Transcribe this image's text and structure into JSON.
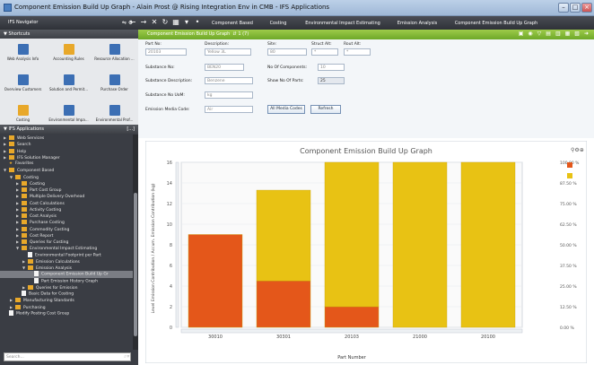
{
  "window": {
    "title": "Component Emission Build Up Graph - Alain Prost @ Rising Integration Env in CMB - IFS Applications"
  },
  "navbar": {
    "title": "IFS Navigator",
    "tabs": [
      "Component Based",
      "Costing",
      "Environmental Impact Estimating",
      "Emission Analysis",
      "Component Emission Build Up Graph"
    ]
  },
  "sidebar": {
    "shortcuts_header": "Shortcuts",
    "shortcuts": [
      "Web Analysis Info",
      "Accounting Rules",
      "Resource Allocation ...",
      "Overview Customers",
      "Solution and Permit...",
      "Purchase Order",
      "Costing",
      "Environmental Impa...",
      "Environmental Prof..."
    ],
    "apps_header": "IFS Applications",
    "tree": [
      {
        "label": "Web Services",
        "depth": 0,
        "kind": "folder",
        "arrow": "right"
      },
      {
        "label": "Search",
        "depth": 0,
        "kind": "folder",
        "arrow": "right"
      },
      {
        "label": "Help",
        "depth": 0,
        "kind": "folder",
        "arrow": "right"
      },
      {
        "label": "IFS Solution Manager",
        "depth": 0,
        "kind": "folder",
        "arrow": "right"
      },
      {
        "label": "Favorites",
        "depth": 0,
        "kind": "star",
        "arrow": ""
      },
      {
        "label": "Component Based",
        "depth": 0,
        "kind": "folder",
        "arrow": "down"
      },
      {
        "label": "Costing",
        "depth": 1,
        "kind": "folder",
        "arrow": "down"
      },
      {
        "label": "Costing",
        "depth": 2,
        "kind": "folder",
        "arrow": "right"
      },
      {
        "label": "Part Cost Group",
        "depth": 2,
        "kind": "folder",
        "arrow": "right"
      },
      {
        "label": "Multiple Delivery Overhead",
        "depth": 2,
        "kind": "folder",
        "arrow": "right"
      },
      {
        "label": "Cost Calculations",
        "depth": 2,
        "kind": "folder",
        "arrow": "right"
      },
      {
        "label": "Activity Costing",
        "depth": 2,
        "kind": "folder",
        "arrow": "right"
      },
      {
        "label": "Cost Analysis",
        "depth": 2,
        "kind": "folder",
        "arrow": "right"
      },
      {
        "label": "Purchase Costing",
        "depth": 2,
        "kind": "folder",
        "arrow": "right"
      },
      {
        "label": "Commodity Costing",
        "depth": 2,
        "kind": "folder",
        "arrow": "right"
      },
      {
        "label": "Cost Report",
        "depth": 2,
        "kind": "folder",
        "arrow": "right"
      },
      {
        "label": "Queries for Costing",
        "depth": 2,
        "kind": "folder",
        "arrow": "right"
      },
      {
        "label": "Environmental Impact Estimating",
        "depth": 2,
        "kind": "folder",
        "arrow": "down"
      },
      {
        "label": "Environmental Footprint per Part",
        "depth": 3,
        "kind": "doc",
        "arrow": ""
      },
      {
        "label": "Emission Calculations",
        "depth": 3,
        "kind": "folder",
        "arrow": "right"
      },
      {
        "label": "Emission Analysis",
        "depth": 3,
        "kind": "folder",
        "arrow": "down"
      },
      {
        "label": "Component Emission Build Up Gr",
        "depth": 4,
        "kind": "doc",
        "arrow": "",
        "selected": true
      },
      {
        "label": "Part Emission History Graph",
        "depth": 4,
        "kind": "doc",
        "arrow": ""
      },
      {
        "label": "Queries for Emission",
        "depth": 3,
        "kind": "folder",
        "arrow": "right"
      },
      {
        "label": "Basic Data for Costing",
        "depth": 2,
        "kind": "doc",
        "arrow": ""
      },
      {
        "label": "Manufacturing Standards",
        "depth": 1,
        "kind": "folder",
        "arrow": "right"
      },
      {
        "label": "Purchasing",
        "depth": 1,
        "kind": "folder",
        "arrow": "right"
      },
      {
        "label": "Modify Posting Cost Group",
        "depth": 0,
        "kind": "doc",
        "arrow": ""
      }
    ],
    "search_placeholder": "Search..."
  },
  "content": {
    "title": "Component Emission Build Up Graph",
    "record": "1 (7)",
    "form": {
      "part_no_label": "Part No:",
      "part_no": "20103",
      "description_label": "Description:",
      "description": "Yellow 3L",
      "site_label": "Site:",
      "site": "80",
      "struct_alt_label": "Struct Alt:",
      "struct_alt": "*",
      "rout_alt_label": "Rout Alt:",
      "rout_alt": "*",
      "substance_no_label": "Substance No:",
      "substance_no": "BEN20",
      "no_components_label": "No Of Components:",
      "no_components": "10",
      "substance_desc_label": "Substance Description:",
      "substance_desc": "Benzene",
      "show_parts_label": "Show No Of Parts:",
      "show_parts": "25",
      "uom_label": "Substance No UoM:",
      "uom": "kg",
      "media_code_label": "Emission Media Code:",
      "media_code": "Air",
      "all_media_button": "All Media Codes",
      "refresh_button": "Refresh"
    }
  },
  "chart_data": {
    "type": "bar",
    "title": "Component Emission Build Up Graph",
    "xlabel": "Part Number",
    "ylabel": "Level Emission Contribution / Accum. Emission Contribution (kg)",
    "categories": [
      "30010",
      "30301",
      "20103",
      "21000",
      "20100"
    ],
    "series": [
      {
        "values": [
          9,
          4.5,
          2,
          0,
          0
        ],
        "color": "#e4571a"
      },
      {
        "values": [
          0,
          8.8,
          15.1,
          17.2,
          17.2
        ],
        "color": "#e8c214"
      }
    ],
    "ylim": [
      0,
      16
    ],
    "y_ticks": [
      "16",
      "14",
      "12",
      "10",
      "8",
      "6",
      "4",
      "2",
      "0"
    ],
    "y2_ticks": [
      "100.00 %",
      "87.50 %",
      "75.00 %",
      "62.50 %",
      "50.00 %",
      "37.50 %",
      "25.00 %",
      "12.50 %",
      "0.00 %"
    ]
  }
}
